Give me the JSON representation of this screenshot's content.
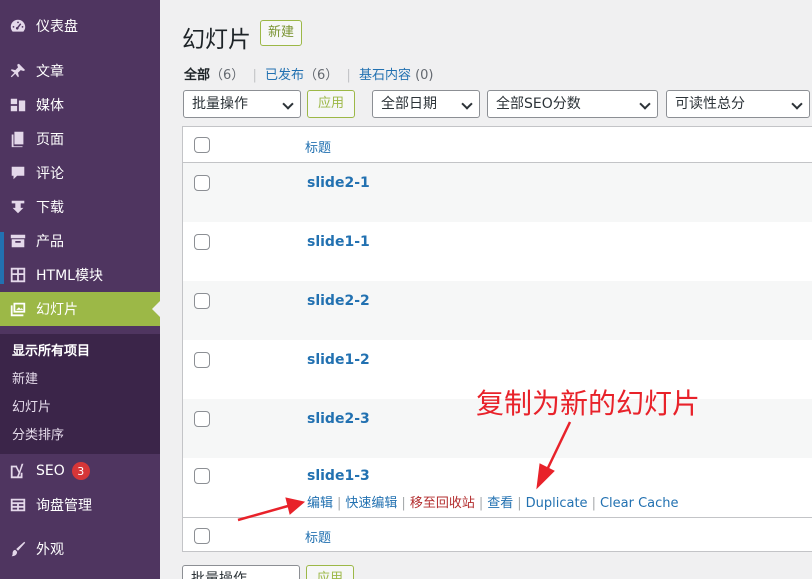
{
  "sidebar": {
    "items": [
      {
        "label": "仪表盘",
        "icon": "dashboard-icon"
      },
      {
        "label": "文章",
        "icon": "pin-icon"
      },
      {
        "label": "媒体",
        "icon": "media-icon"
      },
      {
        "label": "页面",
        "icon": "page-icon"
      },
      {
        "label": "评论",
        "icon": "comment-icon"
      },
      {
        "label": "下载",
        "icon": "download-icon"
      },
      {
        "label": "产品",
        "icon": "archive-icon"
      },
      {
        "label": "HTML模块",
        "icon": "grid-icon"
      },
      {
        "label": "幻灯片",
        "icon": "slides-icon"
      },
      {
        "label": "SEO",
        "icon": "yoast-icon",
        "badge": "3"
      },
      {
        "label": "询盘管理",
        "icon": "table-icon"
      },
      {
        "label": "外观",
        "icon": "brush-icon"
      }
    ],
    "submenu": [
      "显示所有项目",
      "新建",
      "幻灯片",
      "分类排序"
    ]
  },
  "header": {
    "title": "幻灯片",
    "add_new": "新建"
  },
  "views": {
    "all_label": "全部",
    "all_count": "（6）",
    "published_label": "已发布",
    "published_count": "（6）",
    "cornerstone_label": "基石内容",
    "cornerstone_count": "(0)"
  },
  "filters": {
    "bulk_action": "批量操作",
    "apply": "应用",
    "date": "全部日期",
    "seo_score": "全部SEO分数",
    "readability": "可读性总分"
  },
  "table": {
    "column_title": "标题",
    "rows": [
      "slide2-1",
      "slide1-1",
      "slide2-2",
      "slide1-2",
      "slide2-3",
      "slide1-3"
    ],
    "row_actions": [
      "编辑",
      "快速编辑",
      "移至回收站",
      "查看",
      "Duplicate",
      "Clear Cache"
    ]
  },
  "annotation": "复制为新的幻灯片",
  "colors": {
    "sidebar_bg": "#4f3560",
    "accent": "#9cb847",
    "link": "#2271b1",
    "annotation": "#e8222a"
  }
}
